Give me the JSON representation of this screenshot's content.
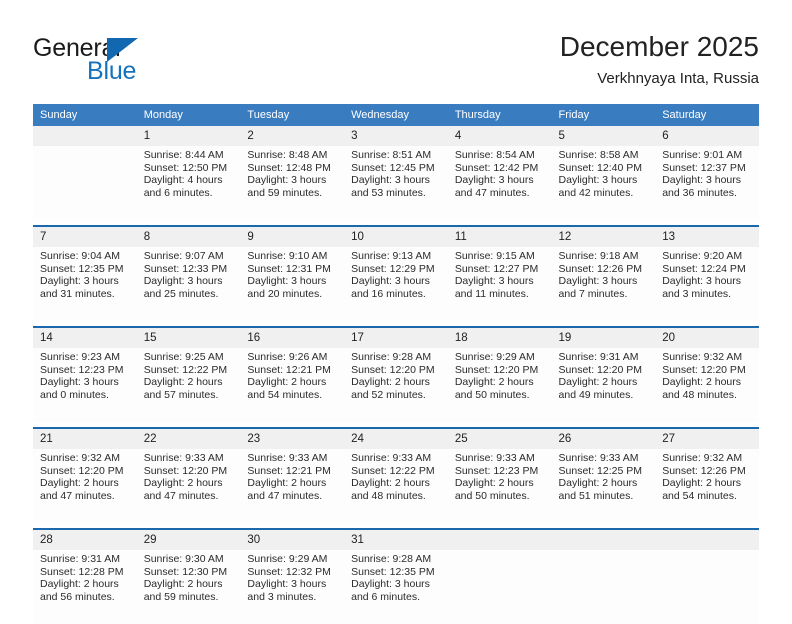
{
  "brand": {
    "name_part1": "General",
    "name_part2": "Blue",
    "logo_icon": "triangle-icon",
    "accent_color": "#1268b0"
  },
  "header": {
    "title": "December 2025",
    "subtitle": "Verkhnyaya Inta, Russia"
  },
  "calendar": {
    "header_bg": "#3a7cc0",
    "daynum_bg": "#f0f0f0",
    "separator_color": "#1b69ad",
    "weekday_headers": [
      "Sunday",
      "Monday",
      "Tuesday",
      "Wednesday",
      "Thursday",
      "Friday",
      "Saturday"
    ],
    "weeks": [
      [
        {
          "day": "",
          "lines": []
        },
        {
          "day": "1",
          "lines": [
            "Sunrise: 8:44 AM",
            "Sunset: 12:50 PM",
            "Daylight: 4 hours",
            "and 6 minutes."
          ]
        },
        {
          "day": "2",
          "lines": [
            "Sunrise: 8:48 AM",
            "Sunset: 12:48 PM",
            "Daylight: 3 hours",
            "and 59 minutes."
          ]
        },
        {
          "day": "3",
          "lines": [
            "Sunrise: 8:51 AM",
            "Sunset: 12:45 PM",
            "Daylight: 3 hours",
            "and 53 minutes."
          ]
        },
        {
          "day": "4",
          "lines": [
            "Sunrise: 8:54 AM",
            "Sunset: 12:42 PM",
            "Daylight: 3 hours",
            "and 47 minutes."
          ]
        },
        {
          "day": "5",
          "lines": [
            "Sunrise: 8:58 AM",
            "Sunset: 12:40 PM",
            "Daylight: 3 hours",
            "and 42 minutes."
          ]
        },
        {
          "day": "6",
          "lines": [
            "Sunrise: 9:01 AM",
            "Sunset: 12:37 PM",
            "Daylight: 3 hours",
            "and 36 minutes."
          ]
        }
      ],
      [
        {
          "day": "7",
          "lines": [
            "Sunrise: 9:04 AM",
            "Sunset: 12:35 PM",
            "Daylight: 3 hours",
            "and 31 minutes."
          ]
        },
        {
          "day": "8",
          "lines": [
            "Sunrise: 9:07 AM",
            "Sunset: 12:33 PM",
            "Daylight: 3 hours",
            "and 25 minutes."
          ]
        },
        {
          "day": "9",
          "lines": [
            "Sunrise: 9:10 AM",
            "Sunset: 12:31 PM",
            "Daylight: 3 hours",
            "and 20 minutes."
          ]
        },
        {
          "day": "10",
          "lines": [
            "Sunrise: 9:13 AM",
            "Sunset: 12:29 PM",
            "Daylight: 3 hours",
            "and 16 minutes."
          ]
        },
        {
          "day": "11",
          "lines": [
            "Sunrise: 9:15 AM",
            "Sunset: 12:27 PM",
            "Daylight: 3 hours",
            "and 11 minutes."
          ]
        },
        {
          "day": "12",
          "lines": [
            "Sunrise: 9:18 AM",
            "Sunset: 12:26 PM",
            "Daylight: 3 hours",
            "and 7 minutes."
          ]
        },
        {
          "day": "13",
          "lines": [
            "Sunrise: 9:20 AM",
            "Sunset: 12:24 PM",
            "Daylight: 3 hours",
            "and 3 minutes."
          ]
        }
      ],
      [
        {
          "day": "14",
          "lines": [
            "Sunrise: 9:23 AM",
            "Sunset: 12:23 PM",
            "Daylight: 3 hours",
            "and 0 minutes."
          ]
        },
        {
          "day": "15",
          "lines": [
            "Sunrise: 9:25 AM",
            "Sunset: 12:22 PM",
            "Daylight: 2 hours",
            "and 57 minutes."
          ]
        },
        {
          "day": "16",
          "lines": [
            "Sunrise: 9:26 AM",
            "Sunset: 12:21 PM",
            "Daylight: 2 hours",
            "and 54 minutes."
          ]
        },
        {
          "day": "17",
          "lines": [
            "Sunrise: 9:28 AM",
            "Sunset: 12:20 PM",
            "Daylight: 2 hours",
            "and 52 minutes."
          ]
        },
        {
          "day": "18",
          "lines": [
            "Sunrise: 9:29 AM",
            "Sunset: 12:20 PM",
            "Daylight: 2 hours",
            "and 50 minutes."
          ]
        },
        {
          "day": "19",
          "lines": [
            "Sunrise: 9:31 AM",
            "Sunset: 12:20 PM",
            "Daylight: 2 hours",
            "and 49 minutes."
          ]
        },
        {
          "day": "20",
          "lines": [
            "Sunrise: 9:32 AM",
            "Sunset: 12:20 PM",
            "Daylight: 2 hours",
            "and 48 minutes."
          ]
        }
      ],
      [
        {
          "day": "21",
          "lines": [
            "Sunrise: 9:32 AM",
            "Sunset: 12:20 PM",
            "Daylight: 2 hours",
            "and 47 minutes."
          ]
        },
        {
          "day": "22",
          "lines": [
            "Sunrise: 9:33 AM",
            "Sunset: 12:20 PM",
            "Daylight: 2 hours",
            "and 47 minutes."
          ]
        },
        {
          "day": "23",
          "lines": [
            "Sunrise: 9:33 AM",
            "Sunset: 12:21 PM",
            "Daylight: 2 hours",
            "and 47 minutes."
          ]
        },
        {
          "day": "24",
          "lines": [
            "Sunrise: 9:33 AM",
            "Sunset: 12:22 PM",
            "Daylight: 2 hours",
            "and 48 minutes."
          ]
        },
        {
          "day": "25",
          "lines": [
            "Sunrise: 9:33 AM",
            "Sunset: 12:23 PM",
            "Daylight: 2 hours",
            "and 50 minutes."
          ]
        },
        {
          "day": "26",
          "lines": [
            "Sunrise: 9:33 AM",
            "Sunset: 12:25 PM",
            "Daylight: 2 hours",
            "and 51 minutes."
          ]
        },
        {
          "day": "27",
          "lines": [
            "Sunrise: 9:32 AM",
            "Sunset: 12:26 PM",
            "Daylight: 2 hours",
            "and 54 minutes."
          ]
        }
      ],
      [
        {
          "day": "28",
          "lines": [
            "Sunrise: 9:31 AM",
            "Sunset: 12:28 PM",
            "Daylight: 2 hours",
            "and 56 minutes."
          ]
        },
        {
          "day": "29",
          "lines": [
            "Sunrise: 9:30 AM",
            "Sunset: 12:30 PM",
            "Daylight: 2 hours",
            "and 59 minutes."
          ]
        },
        {
          "day": "30",
          "lines": [
            "Sunrise: 9:29 AM",
            "Sunset: 12:32 PM",
            "Daylight: 3 hours",
            "and 3 minutes."
          ]
        },
        {
          "day": "31",
          "lines": [
            "Sunrise: 9:28 AM",
            "Sunset: 12:35 PM",
            "Daylight: 3 hours",
            "and 6 minutes."
          ]
        },
        {
          "day": "",
          "lines": []
        },
        {
          "day": "",
          "lines": []
        },
        {
          "day": "",
          "lines": []
        }
      ]
    ]
  }
}
